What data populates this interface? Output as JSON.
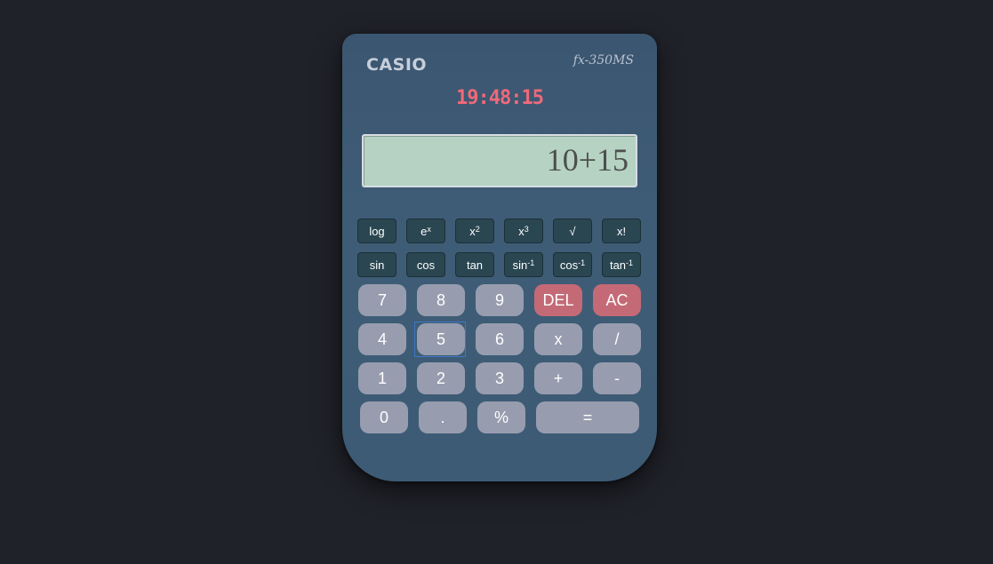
{
  "header": {
    "brand": "CASIO",
    "model": "fx-350MS",
    "clock": "19:48:15"
  },
  "display": {
    "value": "10+15"
  },
  "scientific_row1": [
    {
      "name": "log-button",
      "base": "log",
      "sup": ""
    },
    {
      "name": "exp-button",
      "base": "e",
      "sup": "x"
    },
    {
      "name": "square-button",
      "base": "x",
      "sup": "2"
    },
    {
      "name": "cube-button",
      "base": "x",
      "sup": "3"
    },
    {
      "name": "sqrt-button",
      "base": "√",
      "sup": ""
    },
    {
      "name": "factorial-button",
      "base": "x!",
      "sup": ""
    }
  ],
  "scientific_row2": [
    {
      "name": "sin-button",
      "base": "sin",
      "sup": ""
    },
    {
      "name": "cos-button",
      "base": "cos",
      "sup": ""
    },
    {
      "name": "tan-button",
      "base": "tan",
      "sup": ""
    },
    {
      "name": "arcsin-button",
      "base": "sin",
      "sup": "-1"
    },
    {
      "name": "arccos-button",
      "base": "cos",
      "sup": "-1"
    },
    {
      "name": "arctan-button",
      "base": "tan",
      "sup": "-1"
    }
  ],
  "keys": {
    "k7": "7",
    "k8": "8",
    "k9": "9",
    "del": "DEL",
    "ac": "AC",
    "k4": "4",
    "k5": "5",
    "k6": "6",
    "mul": "x",
    "div": "/",
    "k1": "1",
    "k2": "2",
    "k3": "3",
    "add": "+",
    "sub": "-",
    "k0": "0",
    "dot": ".",
    "pct": "%",
    "eq": "="
  },
  "colors": {
    "background": "#202229",
    "body": "#3e5b75",
    "clock": "#f0697a",
    "screen": "#b5d2c3",
    "key": "#979daf",
    "key_red": "#c46a76",
    "sci_key": "#294651"
  }
}
